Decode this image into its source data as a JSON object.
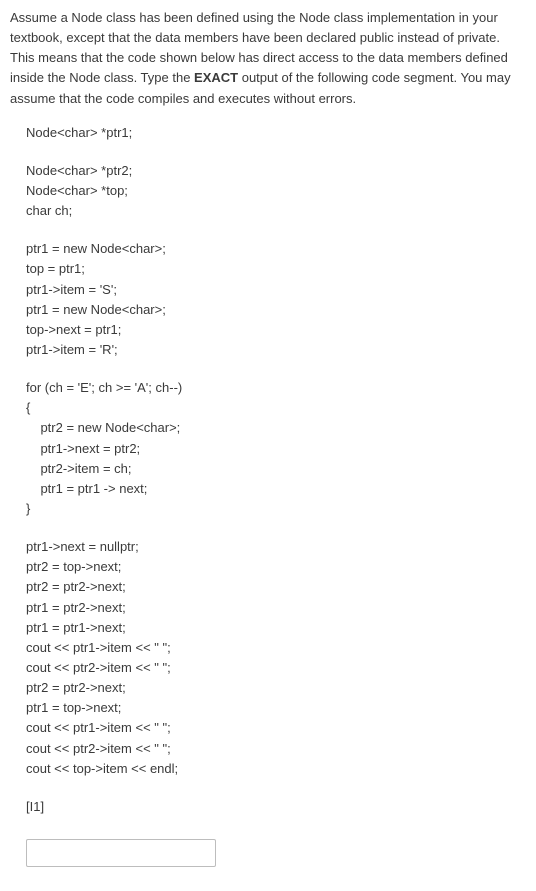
{
  "prompt": {
    "text_leading": "Assume a Node class has been defined using the Node class implementation in your textbook, except that the data members have been declared public instead of private. This means that the code shown below has direct access to the data members defined inside the Node class. Type the ",
    "bold_word": "EXACT",
    "text_trailing": " output of the following code segment. You may assume that the code compiles and executes without errors."
  },
  "code": {
    "block1": [
      "Node<char> *ptr1;"
    ],
    "block2": [
      "Node<char> *ptr2;",
      "Node<char> *top;",
      "char ch;"
    ],
    "block3": [
      "ptr1 = new Node<char>;",
      "top = ptr1;",
      "ptr1->item = 'S';",
      "ptr1 = new Node<char>;",
      "top->next = ptr1;",
      "ptr1->item = 'R';"
    ],
    "block4": [
      "for (ch = 'E'; ch >= 'A'; ch--)",
      "{",
      "    ptr2 = new Node<char>;",
      "    ptr1->next = ptr2;",
      "    ptr2->item = ch;",
      "    ptr1 = ptr1 -> next;",
      "}"
    ],
    "block5": [
      "ptr1->next = nullptr;",
      "ptr2 = top->next;",
      "ptr2 = ptr2->next;",
      "ptr1 = ptr2->next;",
      "ptr1 = ptr1->next;",
      "cout << ptr1->item << \" \";",
      "cout << ptr2->item << \" \";",
      "ptr2 = ptr2->next;",
      "ptr1 = top->next;",
      "cout << ptr1->item << \" \";",
      "cout << ptr2->item << \" \";",
      "cout << top->item << endl;"
    ]
  },
  "points_label": "[I1]",
  "answer_value": ""
}
